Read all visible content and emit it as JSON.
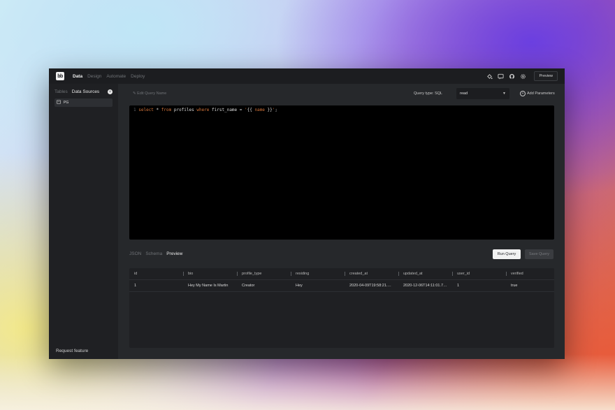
{
  "app": {
    "logo": "bb",
    "nav": [
      "Data",
      "Design",
      "Automate",
      "Deploy"
    ],
    "nav_active": 0,
    "icons": [
      "paint-bucket-icon",
      "chat-icon",
      "github-icon",
      "gear-icon"
    ],
    "preview_label": "Preview"
  },
  "sidebar": {
    "tabs": [
      "Tables",
      "Data Sources"
    ],
    "tab_active": 1,
    "datasources": [
      {
        "label": "PG",
        "icon": "database-icon"
      }
    ],
    "request_feature": "Request feature"
  },
  "query": {
    "name_placeholder": "✎ Edit Query Name",
    "type_label": "Query type: SQL",
    "type_value": "read",
    "add_params_label": "Add Parameters",
    "code": {
      "line_number": "1",
      "select": "select",
      "star": " * ",
      "from": "from",
      "table": " profiles ",
      "where": "where",
      "condition": " first_name = ",
      "quote_open": "'",
      "brace_open": "{{ ",
      "param": "name",
      "brace_close": " }}",
      "quote_close": "'",
      "end": ";"
    }
  },
  "result_tabs": [
    "JSON",
    "Schema",
    "Preview"
  ],
  "result_tab_active": 2,
  "buttons": {
    "run": "Run Query",
    "save": "Save Query"
  },
  "table": {
    "columns": [
      "id",
      "bio",
      "profile_type",
      "residing",
      "created_at",
      "updated_at",
      "user_id",
      "verified"
    ],
    "rows": [
      [
        "1",
        "Hey My Name Is Martin",
        "Creator",
        "Hey",
        "2020-04-09T19:58:21.…",
        "2020-12-06T14:11:01.7…",
        "1",
        "true"
      ]
    ]
  },
  "colors": {
    "accent": "#d4743a",
    "panel": "#26282b",
    "sidebar": "#1f2023",
    "editor": "#000000"
  }
}
